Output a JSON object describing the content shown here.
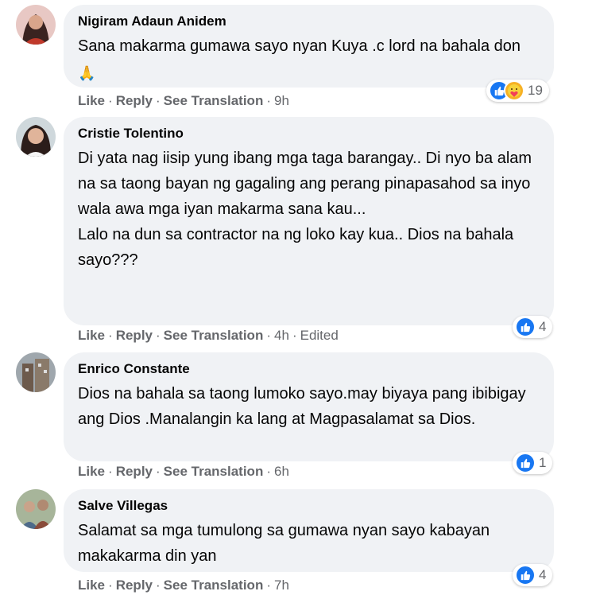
{
  "actions": {
    "like": "Like",
    "reply": "Reply",
    "see_translation": "See Translation",
    "separator": "·"
  },
  "comments": [
    {
      "author": "Nigiram Adaun Anidem",
      "text": "Sana makarma gumawa sayo nyan Kuya .c lord na bahala don",
      "emoji": "🙏",
      "time": "9h",
      "edited": "",
      "reaction_count": "19",
      "reactions": [
        "like-icon",
        "care-icon"
      ]
    },
    {
      "author": "Cristie Tolentino",
      "text": "Di yata nag iisip yung ibang mga taga barangay.. Di nyo ba alam na sa taong bayan ng gagaling ang perang pinapasahod sa inyo wala awa mga iyan makarma sana kau...\nLalo na dun sa contractor na ng loko kay kua.. Dios na bahala\nsayo???",
      "emoji": "",
      "time": "4h",
      "edited": "Edited",
      "reaction_count": "4",
      "reactions": [
        "like-icon"
      ]
    },
    {
      "author": "Enrico Constante",
      "text": "Dios na bahala sa taong lumoko sayo.may biyaya pang ibibigay ang Dios .Manalangin ka lang at Magpasalamat sa Dios.",
      "emoji": "",
      "time": "6h",
      "edited": "",
      "reaction_count": "1",
      "reactions": [
        "like-icon"
      ]
    },
    {
      "author": "Salve Villegas",
      "text": "Salamat sa mga tumulong sa gumawa nyan sayo kabayan makakarma din yan",
      "emoji": "",
      "time": "7h",
      "edited": "",
      "reaction_count": "4",
      "reactions": [
        "like-icon"
      ]
    }
  ],
  "colors": {
    "bubble": "#f0f2f5",
    "like": "#1877f2",
    "care": "#f7b125",
    "meta_text": "#65676b"
  }
}
